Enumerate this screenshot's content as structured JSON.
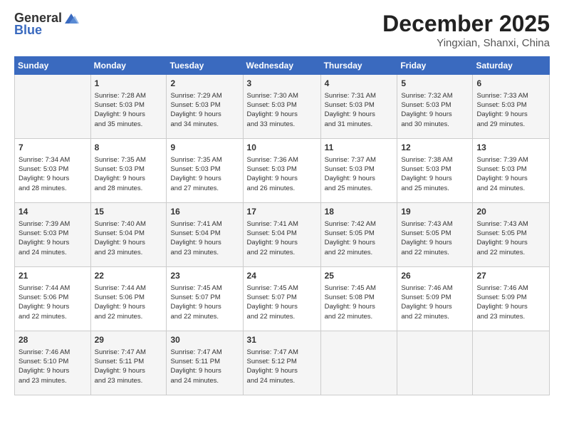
{
  "header": {
    "logo_general": "General",
    "logo_blue": "Blue",
    "month": "December 2025",
    "location": "Yingxian, Shanxi, China"
  },
  "weekdays": [
    "Sunday",
    "Monday",
    "Tuesday",
    "Wednesday",
    "Thursday",
    "Friday",
    "Saturday"
  ],
  "weeks": [
    [
      {
        "day": "",
        "info": ""
      },
      {
        "day": "1",
        "info": "Sunrise: 7:28 AM\nSunset: 5:03 PM\nDaylight: 9 hours\nand 35 minutes."
      },
      {
        "day": "2",
        "info": "Sunrise: 7:29 AM\nSunset: 5:03 PM\nDaylight: 9 hours\nand 34 minutes."
      },
      {
        "day": "3",
        "info": "Sunrise: 7:30 AM\nSunset: 5:03 PM\nDaylight: 9 hours\nand 33 minutes."
      },
      {
        "day": "4",
        "info": "Sunrise: 7:31 AM\nSunset: 5:03 PM\nDaylight: 9 hours\nand 31 minutes."
      },
      {
        "day": "5",
        "info": "Sunrise: 7:32 AM\nSunset: 5:03 PM\nDaylight: 9 hours\nand 30 minutes."
      },
      {
        "day": "6",
        "info": "Sunrise: 7:33 AM\nSunset: 5:03 PM\nDaylight: 9 hours\nand 29 minutes."
      }
    ],
    [
      {
        "day": "7",
        "info": "Sunrise: 7:34 AM\nSunset: 5:03 PM\nDaylight: 9 hours\nand 28 minutes."
      },
      {
        "day": "8",
        "info": "Sunrise: 7:35 AM\nSunset: 5:03 PM\nDaylight: 9 hours\nand 28 minutes."
      },
      {
        "day": "9",
        "info": "Sunrise: 7:35 AM\nSunset: 5:03 PM\nDaylight: 9 hours\nand 27 minutes."
      },
      {
        "day": "10",
        "info": "Sunrise: 7:36 AM\nSunset: 5:03 PM\nDaylight: 9 hours\nand 26 minutes."
      },
      {
        "day": "11",
        "info": "Sunrise: 7:37 AM\nSunset: 5:03 PM\nDaylight: 9 hours\nand 25 minutes."
      },
      {
        "day": "12",
        "info": "Sunrise: 7:38 AM\nSunset: 5:03 PM\nDaylight: 9 hours\nand 25 minutes."
      },
      {
        "day": "13",
        "info": "Sunrise: 7:39 AM\nSunset: 5:03 PM\nDaylight: 9 hours\nand 24 minutes."
      }
    ],
    [
      {
        "day": "14",
        "info": "Sunrise: 7:39 AM\nSunset: 5:03 PM\nDaylight: 9 hours\nand 24 minutes."
      },
      {
        "day": "15",
        "info": "Sunrise: 7:40 AM\nSunset: 5:04 PM\nDaylight: 9 hours\nand 23 minutes."
      },
      {
        "day": "16",
        "info": "Sunrise: 7:41 AM\nSunset: 5:04 PM\nDaylight: 9 hours\nand 23 minutes."
      },
      {
        "day": "17",
        "info": "Sunrise: 7:41 AM\nSunset: 5:04 PM\nDaylight: 9 hours\nand 22 minutes."
      },
      {
        "day": "18",
        "info": "Sunrise: 7:42 AM\nSunset: 5:05 PM\nDaylight: 9 hours\nand 22 minutes."
      },
      {
        "day": "19",
        "info": "Sunrise: 7:43 AM\nSunset: 5:05 PM\nDaylight: 9 hours\nand 22 minutes."
      },
      {
        "day": "20",
        "info": "Sunrise: 7:43 AM\nSunset: 5:05 PM\nDaylight: 9 hours\nand 22 minutes."
      }
    ],
    [
      {
        "day": "21",
        "info": "Sunrise: 7:44 AM\nSunset: 5:06 PM\nDaylight: 9 hours\nand 22 minutes."
      },
      {
        "day": "22",
        "info": "Sunrise: 7:44 AM\nSunset: 5:06 PM\nDaylight: 9 hours\nand 22 minutes."
      },
      {
        "day": "23",
        "info": "Sunrise: 7:45 AM\nSunset: 5:07 PM\nDaylight: 9 hours\nand 22 minutes."
      },
      {
        "day": "24",
        "info": "Sunrise: 7:45 AM\nSunset: 5:07 PM\nDaylight: 9 hours\nand 22 minutes."
      },
      {
        "day": "25",
        "info": "Sunrise: 7:45 AM\nSunset: 5:08 PM\nDaylight: 9 hours\nand 22 minutes."
      },
      {
        "day": "26",
        "info": "Sunrise: 7:46 AM\nSunset: 5:09 PM\nDaylight: 9 hours\nand 22 minutes."
      },
      {
        "day": "27",
        "info": "Sunrise: 7:46 AM\nSunset: 5:09 PM\nDaylight: 9 hours\nand 23 minutes."
      }
    ],
    [
      {
        "day": "28",
        "info": "Sunrise: 7:46 AM\nSunset: 5:10 PM\nDaylight: 9 hours\nand 23 minutes."
      },
      {
        "day": "29",
        "info": "Sunrise: 7:47 AM\nSunset: 5:11 PM\nDaylight: 9 hours\nand 23 minutes."
      },
      {
        "day": "30",
        "info": "Sunrise: 7:47 AM\nSunset: 5:11 PM\nDaylight: 9 hours\nand 24 minutes."
      },
      {
        "day": "31",
        "info": "Sunrise: 7:47 AM\nSunset: 5:12 PM\nDaylight: 9 hours\nand 24 minutes."
      },
      {
        "day": "",
        "info": ""
      },
      {
        "day": "",
        "info": ""
      },
      {
        "day": "",
        "info": ""
      }
    ]
  ]
}
